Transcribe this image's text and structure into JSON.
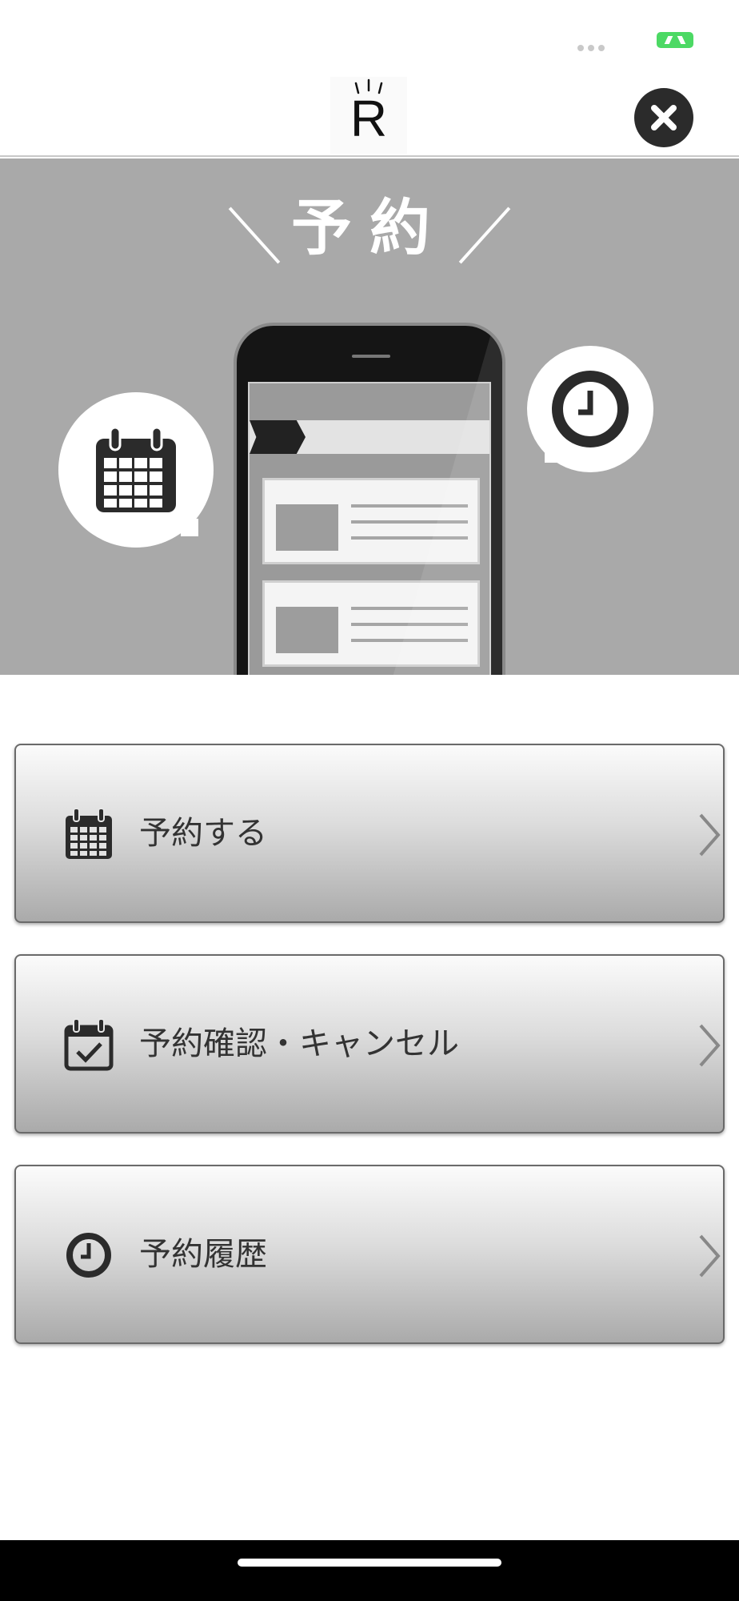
{
  "header": {
    "logo_letter": "R",
    "close_icon": "close-icon"
  },
  "hero": {
    "title": "予約",
    "icons": [
      "calendar-icon",
      "clock-icon",
      "smartphone-illustration"
    ]
  },
  "menu": {
    "items": [
      {
        "label": "予約する",
        "icon": "calendar-icon"
      },
      {
        "label": "予約確認・キャンセル",
        "icon": "calendar-check-icon"
      },
      {
        "label": "予約履歴",
        "icon": "clock-icon"
      }
    ]
  },
  "colors": {
    "hero_background": "#a9a9a9",
    "button_gradient_top": "#fbfbfb",
    "button_gradient_bottom": "#aaaaaa",
    "label_text": "#333333",
    "battery": "#4cd964",
    "close_button": "#2b2b2b"
  }
}
